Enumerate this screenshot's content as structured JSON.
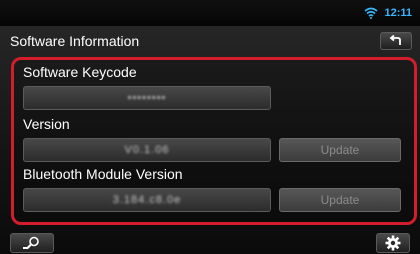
{
  "status": {
    "time": "12:11",
    "icon": "wifi-icon"
  },
  "header": {
    "title": "Software Information",
    "back_icon": "back-arrow-icon"
  },
  "sections": {
    "software_keycode": {
      "label": "Software Keycode",
      "value": "••••••••"
    },
    "version": {
      "label": "Version",
      "value": "V0.1.06",
      "update_label": "Update"
    },
    "bluetooth": {
      "label": "Bluetooth Module Version",
      "value": "3.184.c8.0e",
      "update_label": "Update"
    }
  },
  "bottom": {
    "left_icon": "search-icon",
    "right_icon": "gear-icon"
  },
  "colors": {
    "highlight": "#d41d2b",
    "time": "#39b6ff"
  }
}
